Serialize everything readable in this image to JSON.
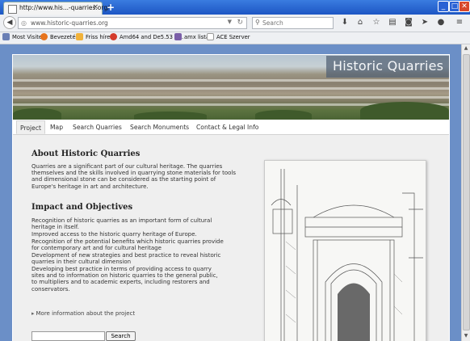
{
  "browser": {
    "tab_title": "http://www.his...-quarries.org/",
    "url": "www.historic-quarries.org",
    "search_placeholder": "Search",
    "new_tab": "+",
    "tab_close": "×"
  },
  "bookmarks": [
    {
      "label": "Most Visited",
      "color": "#6a7fb5"
    },
    {
      "label": "Bevezetés",
      "color": "#e7731c"
    },
    {
      "label": "Friss hírek",
      "color": "#f1b23a"
    },
    {
      "label": "Amd64 and De5.53 - ...",
      "color": "#d43b2b"
    },
    {
      "label": "amx lista",
      "color": "#7b5fa8"
    },
    {
      "label": "ACE Szerver",
      "color": "#ffffff"
    }
  ],
  "site": {
    "banner_title": "Historic Quarries",
    "menu": [
      "Project",
      "Map",
      "Search Quarries",
      "Search Monuments",
      "Contact & Legal Info"
    ],
    "about_heading": "About Historic Quarries",
    "about_text": "Quarries are a significant part of our cultural heritage. The quarries themselves and the skills involved in quarrying stone materials for tools and dimensional stone can be considered as the starting point of Europe's heritage in art and architecture.",
    "impact_heading": "Impact and Objectives",
    "objectives": [
      "Recognition of historic quarries as an important form of cultural heritage in itself.",
      "Improved access to the historic quarry heritage of Europe.",
      "Recognition of the potential benefits which historic quarries provide for contemporary art and for cultural heritage",
      "Development of new strategies and best practice to reveal historic quarries in their cultural dimension",
      "Developing best practice in terms of providing access to quarry sites and to information on historic quarries to the general public, to multipliers and to academic experts, including restorers and conservators."
    ],
    "more_link": "More information about the project",
    "search_button": "Search",
    "search_value": ""
  },
  "icons": [
    "back-icon",
    "globe-icon",
    "dropdown-icon",
    "reload-icon",
    "search-icon",
    "download-icon",
    "home-icon",
    "star-icon",
    "library-icon",
    "pocket-icon",
    "send-icon",
    "chat-icon",
    "menu-icon"
  ]
}
